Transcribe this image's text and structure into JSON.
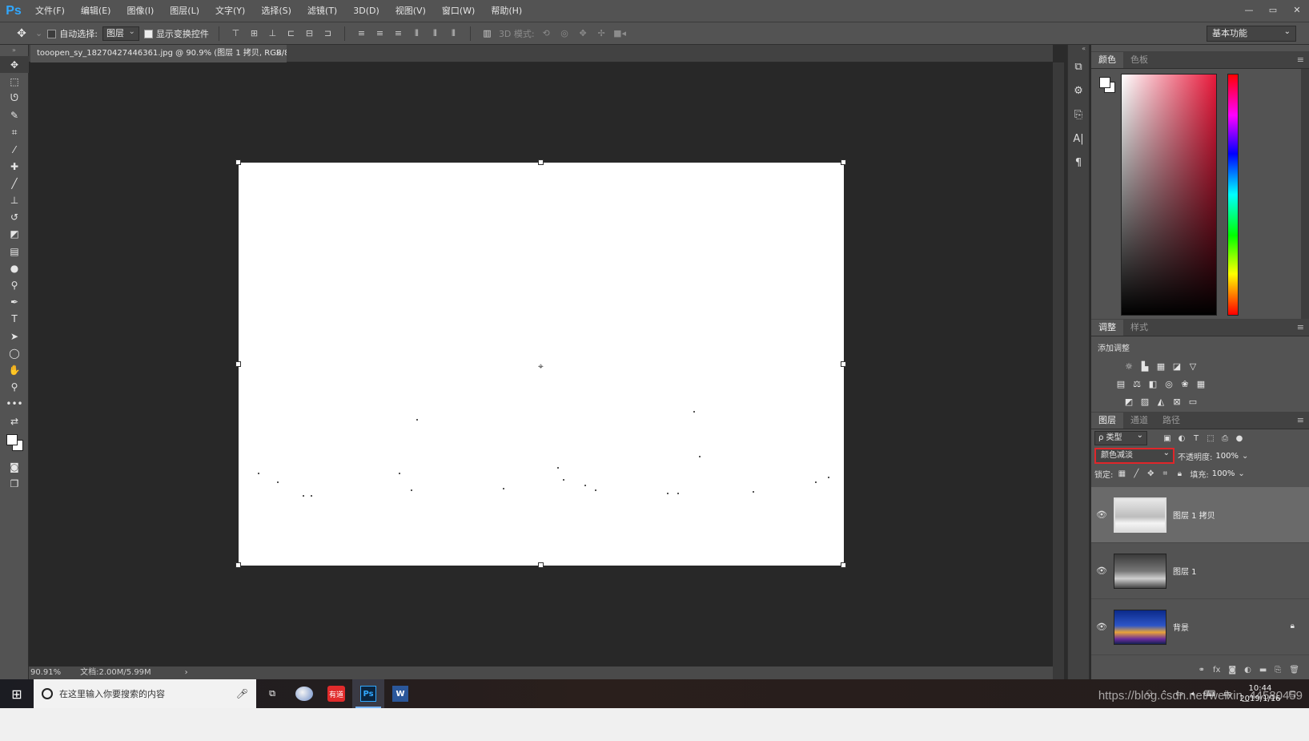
{
  "app": {
    "logo": "Ps",
    "menu": [
      "文件(F)",
      "编辑(E)",
      "图像(I)",
      "图层(L)",
      "文字(Y)",
      "选择(S)",
      "滤镜(T)",
      "3D(D)",
      "视图(V)",
      "窗口(W)",
      "帮助(H)"
    ],
    "window_controls": [
      "—",
      "▭",
      "✕"
    ]
  },
  "options_bar": {
    "auto_select_label": "自动选择:",
    "auto_select_value": "图层",
    "show_transform_label": "显示变换控件",
    "mode_3d_label": "3D 模式:",
    "workspace": "基本功能"
  },
  "document": {
    "tab_title": "tooopen_sy_182704274463­61.jpg @ 90.9% (图层 1 拷贝, RGB/8#) *",
    "tab_close": "×",
    "zoom": "90.91%",
    "doc_size": "文档:2.00M/5.99M",
    "status_arrow": "›"
  },
  "color_panel": {
    "tabs": [
      "颜色",
      "色板"
    ],
    "foreground": "#ffffff",
    "background": "#ffffff",
    "hue_color": "#e8183a"
  },
  "adjustments_panel": {
    "tabs": [
      "调整",
      "样式"
    ],
    "title": "添加调整"
  },
  "layers_panel": {
    "tabs": [
      "图层",
      "通道",
      "路径"
    ],
    "kind_filter": "ρ 类型",
    "blend_mode": "颜色减淡",
    "opacity_label": "不透明度:",
    "opacity_value": "100%",
    "lock_label": "锁定:",
    "fill_label": "填充:",
    "fill_value": "100%",
    "layers": [
      {
        "name": "图层 1 拷贝",
        "visible": true,
        "selected": true,
        "locked": false
      },
      {
        "name": "图层 1",
        "visible": true,
        "selected": false,
        "locked": false
      },
      {
        "name": "背景",
        "visible": true,
        "selected": false,
        "locked": true
      }
    ]
  },
  "taskbar": {
    "search_placeholder": "在这里输入你要搜索的内容",
    "apps": [
      "task-view",
      "paint",
      "youdao",
      "photoshop",
      "word"
    ],
    "youdao_label": "有道",
    "ps_label": "Ps",
    "word_label": "W",
    "clock_time": "10:44",
    "clock_date": "2019/1/16"
  },
  "watermark": "https://blog.csdn.net/weixin_44580459"
}
